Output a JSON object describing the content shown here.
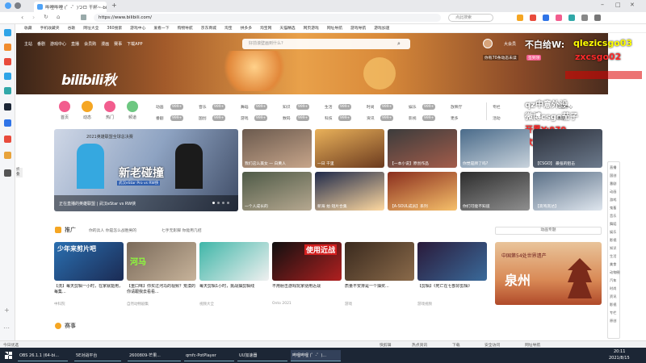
{
  "browser": {
    "tab_title": "哔哩哔哩 (゜-゜)つロ 干杯~-bili...",
    "url": "https://www.bilibili.com/",
    "search_placeholder": "点此搜索",
    "bookmarks": [
      "收藏",
      "手机收藏夹",
      "谷歌",
      "网址大全",
      "360搜索",
      "游戏中心",
      "爱看一下",
      "购物导航",
      "京东商城",
      "淘宝",
      "拼多多",
      "淘宝网",
      "天猫精选",
      "网页游戏",
      "网址导航",
      "游戏导航",
      "游戏加速"
    ]
  },
  "sidebar": {
    "colors": [
      "#2fa4e7",
      "#f08c2e",
      "#e84b3c",
      "#2fa4e7",
      "#31a8a8",
      "#1c2635",
      "#2f74e7",
      "#e84b3c",
      "#e8a33b",
      "#555555"
    ],
    "collapse_label": "折叠"
  },
  "banner": {
    "nav": [
      "主站",
      "番剧",
      "游戏中心",
      "直播",
      "会员购",
      "漫画",
      "赛事",
      "下载APP"
    ],
    "search_placeholder": "好前滚壁画到什么?",
    "logo_text": "bilibili秋",
    "username": "大会员",
    "subtext": "你有70条动态未读",
    "badge": "签到领"
  },
  "overlays": [
    {
      "text": "不白给W:",
      "color": "#ffffff"
    },
    {
      "text": "qlezicsgo03",
      "color": "#ffff00"
    },
    {
      "text": "zxcsgo02",
      "color": "#ff2a2a"
    },
    {
      "text": "qz中意外设",
      "color": "#ffffff"
    },
    {
      "text": "微博csgo茄子",
      "color": "#ffffff"
    },
    {
      "text": "开黑Y:970",
      "color": "#ff2a2a"
    },
    {
      "text": "欢迎进群",
      "color": "#ff2a2a"
    }
  ],
  "channels": [
    {
      "label": "首页",
      "color": "#f25d8e"
    },
    {
      "label": "动态",
      "color": "#f5a623"
    },
    {
      "label": "热门",
      "color": "#f25d8e"
    },
    {
      "label": "频道",
      "color": "#6dc781"
    }
  ],
  "categories": [
    [
      "动画",
      "音乐",
      "舞蹈",
      "知识",
      "生活",
      "时尚",
      "娱乐",
      "放映厅"
    ],
    [
      "番剧",
      "国创",
      "游戏",
      "数码",
      "科技",
      "资讯",
      "影视",
      "更多"
    ]
  ],
  "category_counts": [
    "999+",
    "999+",
    "999+",
    "999+",
    "999+",
    "999+",
    "999+",
    "999+",
    "999+",
    "999+",
    "999+",
    "999+",
    "999+",
    "999+",
    "999+"
  ],
  "right_links": [
    "专栏",
    "活动",
    "社区中心",
    "直播",
    "课堂",
    "新歌热榜"
  ],
  "carousel": {
    "title": "2021英雄联盟全球总决赛",
    "caption": "正在直播的英雄联盟 | 武汉eStar vs RW侠",
    "sub": "武汉eStar Pro vs RW侠"
  },
  "grid_videos": [
    {
      "title": "我们这么美女 一 白黄人"
    },
    {
      "title": "一日 千里"
    },
    {
      "title": "【一本小说】原创作品"
    },
    {
      "title": "你觉是牌了吗?"
    },
    {
      "title": "【CSGO】 最强的狙击"
    },
    {
      "title": "一个人成长的"
    },
    {
      "title": "新海 拍 短片合集"
    },
    {
      "title": "【A-SOUL成员】系列"
    },
    {
      "title": "你们可能不知道"
    },
    {
      "title": "【高笃高达】"
    }
  ],
  "promo": {
    "label": "推广",
    "hot1": "你的兵人 你是怎么战胜男的",
    "hot2": "七手无影脚 你能用几招"
  },
  "promo_videos": [
    {
      "title": "【流】每天剪辑一小时，在家就能用，每集...",
      "meta": "中科院",
      "tag": "少年来剪片吧"
    },
    {
      "title": "【重口味】你买过河马的视频？荒漠的你请跟我去看看...",
      "meta": "自然动物剧集",
      "tag": "河马"
    },
    {
      "title": "每天剪辑1小时，挑战抽剪辑线",
      "meta": "视频大全"
    },
    {
      "title": "不用射击游戏玩家便用近战",
      "meta": "Onto 2021"
    },
    {
      "title": "质量不安排是一个抽奖...",
      "meta": "游戏",
      "tag": "使用近战"
    },
    {
      "title": "【剪辑】《死亡在七部好剪辑》",
      "meta": "游戏视频"
    }
  ],
  "ad_banner": {
    "title": "中国第54处世界遗产",
    "sub": "泉州",
    "label": "动画专题"
  },
  "section": {
    "title": "赛事"
  },
  "right_index": [
    "直播",
    "国创",
    "番剧",
    "动画",
    "游戏",
    "鬼畜",
    "音乐",
    "舞蹈",
    "娱乐",
    "影视",
    "知识",
    "生活",
    "美食",
    "动物圈",
    "汽车",
    "时尚",
    "资讯",
    "影视",
    "专栏",
    "原创"
  ],
  "status_bar": {
    "left": "今日优选",
    "right": [
      "快剪辑",
      "热点资讯",
      "下载",
      "安全访问",
      "网址导航"
    ]
  },
  "taskbar": {
    "items": [
      "OBS 26.1.1 (64-bi...",
      "5E对战平台",
      "2600809-芒果...",
      "qmfc-PotPlayer",
      "UU加速器",
      "哔哩哔哩 (゜-゜)..."
    ],
    "time": "20:11",
    "date": "2021/8/15"
  }
}
